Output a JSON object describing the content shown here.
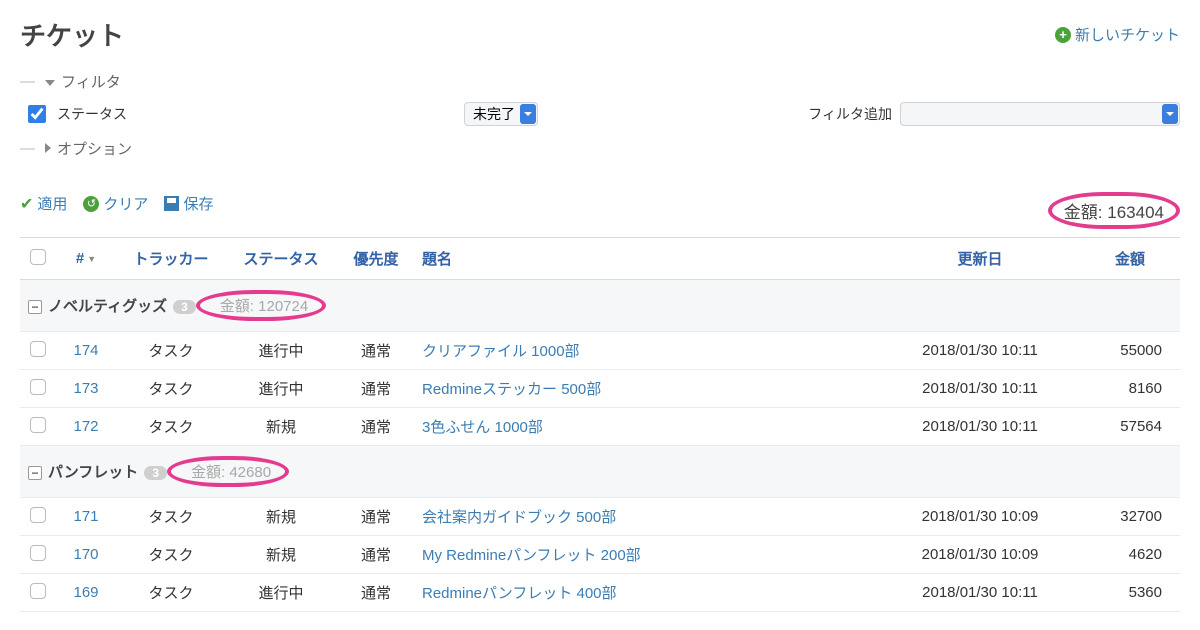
{
  "header": {
    "title": "チケット",
    "new_ticket": "新しいチケット"
  },
  "filters": {
    "label": "フィルタ",
    "status_label": "ステータス",
    "status_value": "未完了",
    "add_filter_label": "フィルタ追加"
  },
  "options": {
    "label": "オプション"
  },
  "actions": {
    "apply": "適用",
    "clear": "クリア",
    "save": "保存"
  },
  "totals": {
    "amount_label": "金額:",
    "amount_value": "163404"
  },
  "columns": {
    "id": "#",
    "tracker": "トラッカー",
    "status": "ステータス",
    "priority": "優先度",
    "subject": "題名",
    "updated": "更新日",
    "amount": "金額"
  },
  "groups": [
    {
      "name": "ノベルティグッズ",
      "count": "3",
      "amount_label": "金額:",
      "amount_value": "120724",
      "rows": [
        {
          "id": "174",
          "tracker": "タスク",
          "status": "進行中",
          "priority": "通常",
          "subject": "クリアファイル 1000部",
          "updated": "2018/01/30 10:11",
          "amount": "55000"
        },
        {
          "id": "173",
          "tracker": "タスク",
          "status": "進行中",
          "priority": "通常",
          "subject": "Redmineステッカー 500部",
          "updated": "2018/01/30 10:11",
          "amount": "8160"
        },
        {
          "id": "172",
          "tracker": "タスク",
          "status": "新規",
          "priority": "通常",
          "subject": "3色ふせん 1000部",
          "updated": "2018/01/30 10:11",
          "amount": "57564"
        }
      ]
    },
    {
      "name": "パンフレット",
      "count": "3",
      "amount_label": "金額:",
      "amount_value": "42680",
      "rows": [
        {
          "id": "171",
          "tracker": "タスク",
          "status": "新規",
          "priority": "通常",
          "subject": "会社案内ガイドブック 500部",
          "updated": "2018/01/30 10:09",
          "amount": "32700"
        },
        {
          "id": "170",
          "tracker": "タスク",
          "status": "新規",
          "priority": "通常",
          "subject": "My Redmineパンフレット 200部",
          "updated": "2018/01/30 10:09",
          "amount": "4620"
        },
        {
          "id": "169",
          "tracker": "タスク",
          "status": "進行中",
          "priority": "通常",
          "subject": "Redmineパンフレット 400部",
          "updated": "2018/01/30 10:11",
          "amount": "5360"
        }
      ]
    }
  ]
}
